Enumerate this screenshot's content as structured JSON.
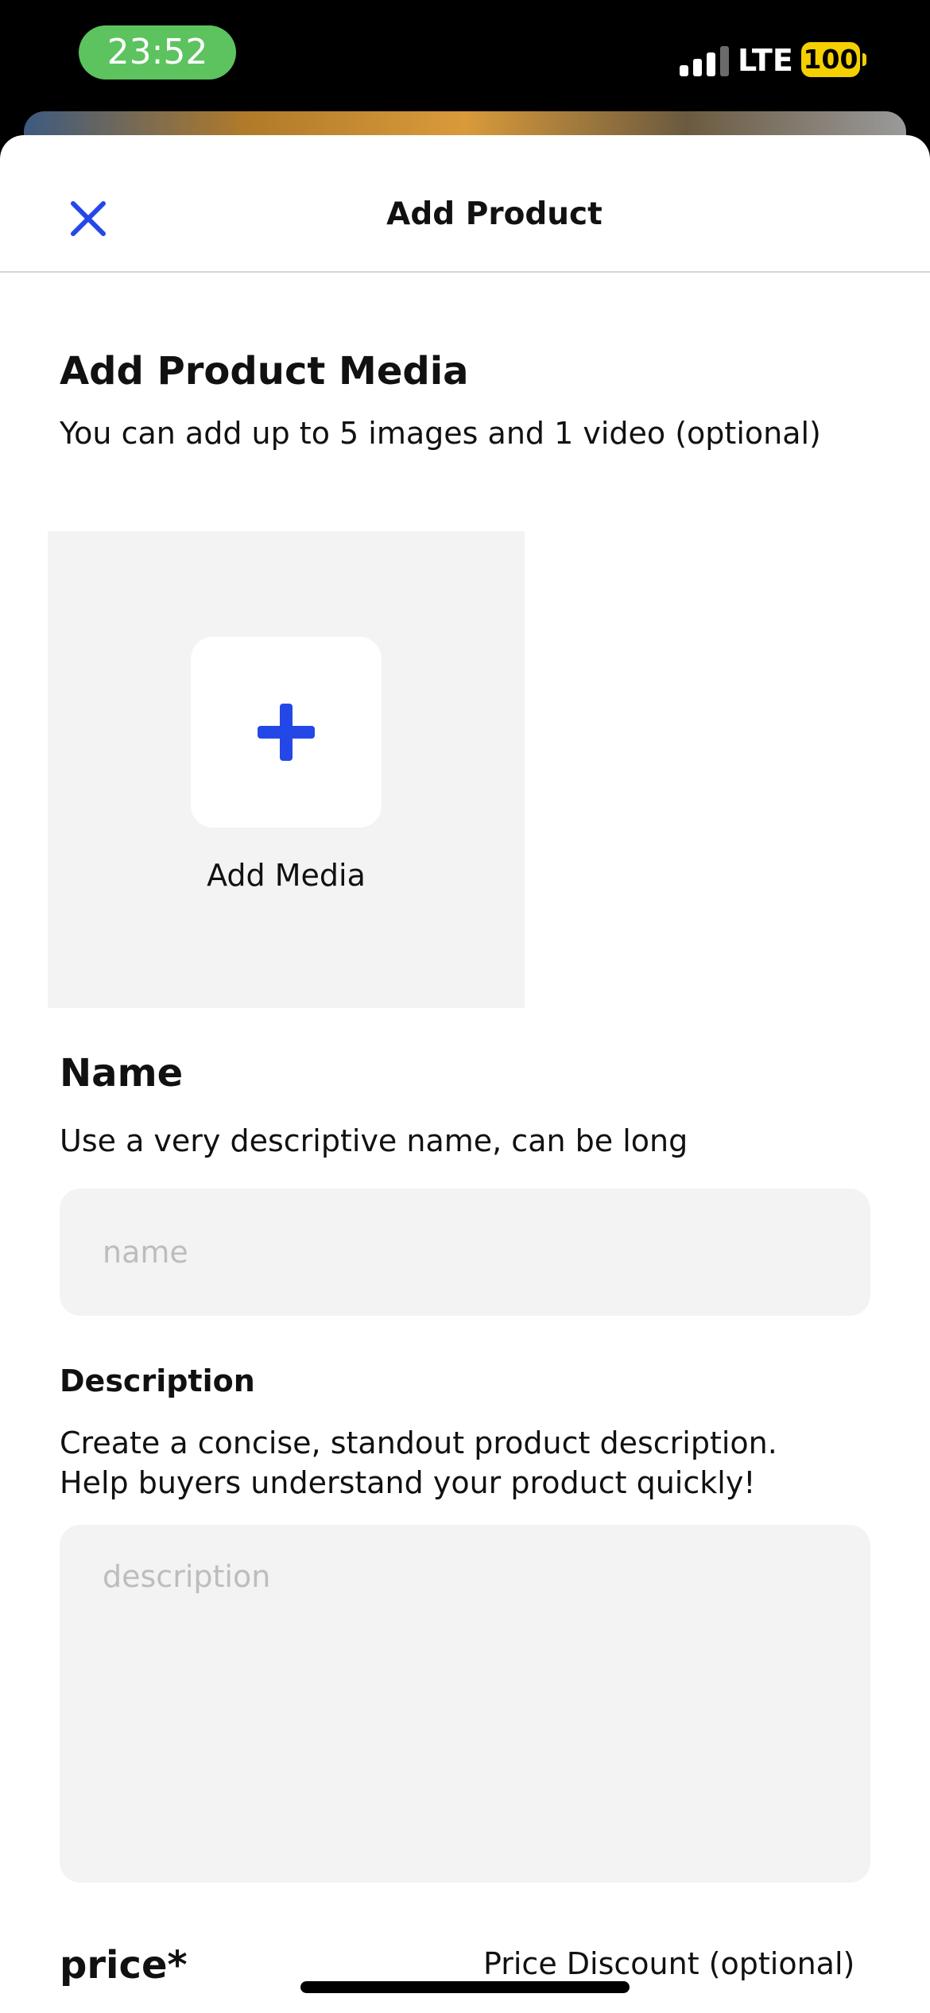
{
  "status_bar": {
    "time": "23:52",
    "network": "LTE",
    "battery": "100"
  },
  "header": {
    "title": "Add Product",
    "close_icon": "close-icon"
  },
  "media_section": {
    "heading": "Add Product Media",
    "subtitle": "You can add up to 5 images and 1 video (optional)",
    "add_button_label": "Add Media",
    "add_icon": "plus-icon"
  },
  "name_section": {
    "heading": "Name",
    "subtitle": "Use a very descriptive name, can be long",
    "placeholder": "name",
    "value": ""
  },
  "description_section": {
    "heading": "Description",
    "subtitle": " Create a concise, standout product description.\nHelp buyers understand your product quickly!",
    "placeholder": "description",
    "value": ""
  },
  "price_section": {
    "price_label": "price*",
    "discount_label": "Price Discount (optional)"
  },
  "colors": {
    "accent": "#2448e8",
    "time_pill": "#5cc35f",
    "battery": "#f5d000",
    "field_bg": "#f3f3f3",
    "placeholder": "#bdbdbd"
  }
}
